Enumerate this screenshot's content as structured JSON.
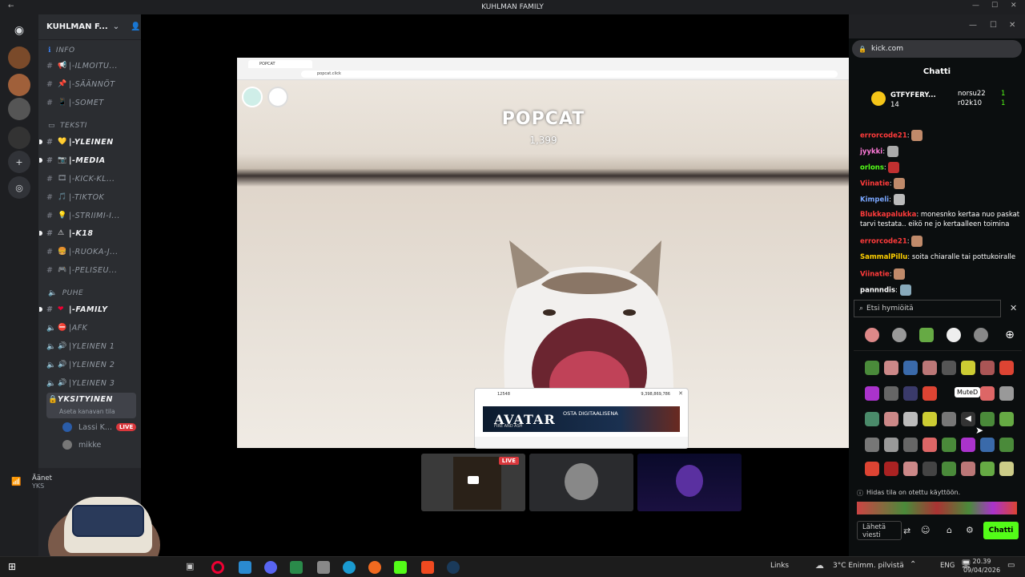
{
  "window": {
    "title": "KUHLMAN FAMILY"
  },
  "server": {
    "name": "KUHLMAN F..."
  },
  "categories": {
    "info": "INFO",
    "teksti": "TEKSTI",
    "puhe": "PUHE"
  },
  "channels": [
    {
      "label": "|-ILMOITU...",
      "emoji": "📢"
    },
    {
      "label": "|-SÄÄNNÖT",
      "emoji": "📌"
    },
    {
      "label": "|-SOMET",
      "emoji": "📱"
    },
    {
      "label": "|-YLEINEN",
      "emoji": "💛"
    },
    {
      "label": "|-MEDIA",
      "emoji": "📷"
    },
    {
      "label": "|-KICK-KL...",
      "emoji": "🎞"
    },
    {
      "label": "|-TIKTOK",
      "emoji": "🎵"
    },
    {
      "label": "|-STRIIMI-I...",
      "emoji": "💡"
    },
    {
      "label": "|-K18",
      "emoji": "⚠"
    },
    {
      "label": "|-RUOKA-J...",
      "emoji": "🍔"
    },
    {
      "label": "|-PELISEU...",
      "emoji": "🎮"
    }
  ],
  "voice": [
    {
      "label": "|-FAMILY",
      "emoji": "❤"
    },
    {
      "label": "|AFK"
    },
    {
      "label": "|YLEINEN 1"
    },
    {
      "label": "|YLEINEN 2"
    },
    {
      "label": "|YLEINEN 3"
    },
    {
      "label": "YKSITYINEN",
      "sub": "Aseta kanavan tila"
    }
  ],
  "voice_users": [
    {
      "name": "Lassi K...",
      "badge": "LIVE"
    },
    {
      "name": "mikke"
    }
  ],
  "voice_status": {
    "line1": "Äänet",
    "line2": "YKS"
  },
  "stream": {
    "tab_label": "POPCAT",
    "url": "popcat.click",
    "title": "POPCAT",
    "count": "1,399",
    "overlay_left": "12548",
    "overlay_right": "9,398,869,786",
    "ad_title": "AVATAR",
    "ad_sub": "FIRE AND ASH",
    "ad_cta": "OSTA DIGITAALISENA"
  },
  "thumbs": [
    {
      "badge": "LIVE"
    },
    {},
    {}
  ],
  "browser": {
    "url": "kick.com",
    "panel_title": "Chatti"
  },
  "chat": {
    "pinned": {
      "name": "GTFYFERY...",
      "count": "14",
      "users": [
        {
          "name": "norsu22",
          "n": "1"
        },
        {
          "name": "r02k10",
          "n": "1"
        }
      ]
    },
    "messages": [
      {
        "user": "errorcode21",
        "text": "",
        "color": "#ff3b3b"
      },
      {
        "user": "jyykki",
        "text": "",
        "color": "#ff7ad9"
      },
      {
        "user": "orlons",
        "text": "",
        "color": "#53fc18"
      },
      {
        "user": "Viinatie",
        "text": "",
        "color": "#ff3b3b"
      },
      {
        "user": "Kimpeli",
        "text": "",
        "color": "#7aa7ff"
      },
      {
        "user": "Blukkapalukka",
        "text": "monesnko kertaa nuo paskat tarvi testata.. eikö ne jo kertaalleen toimina",
        "color": "#ff3b3b"
      },
      {
        "user": "errorcode21",
        "text": "",
        "color": "#ff3b3b"
      },
      {
        "user": "SammalPillu",
        "text": "soita chiaralle tai pottukoiralle",
        "color": "#ffd000"
      },
      {
        "user": "Viinatie",
        "text": "",
        "color": "#ff3b3b"
      },
      {
        "user": "pannndis",
        "text": "",
        "color": "#fff"
      }
    ],
    "emote_search_placeholder": "Etsi hymiöitä",
    "tooltip": "MuteD",
    "slow_mode": "Hidas tila on otettu käyttöön.",
    "send_placeholder": "Lähetä viesti",
    "send_button": "Chatti"
  },
  "taskbar": {
    "links": "Links",
    "weather": "3°C  Enimm. pilvistä",
    "lang": "ENG",
    "time": "20.39",
    "date": "09/04/2026"
  }
}
